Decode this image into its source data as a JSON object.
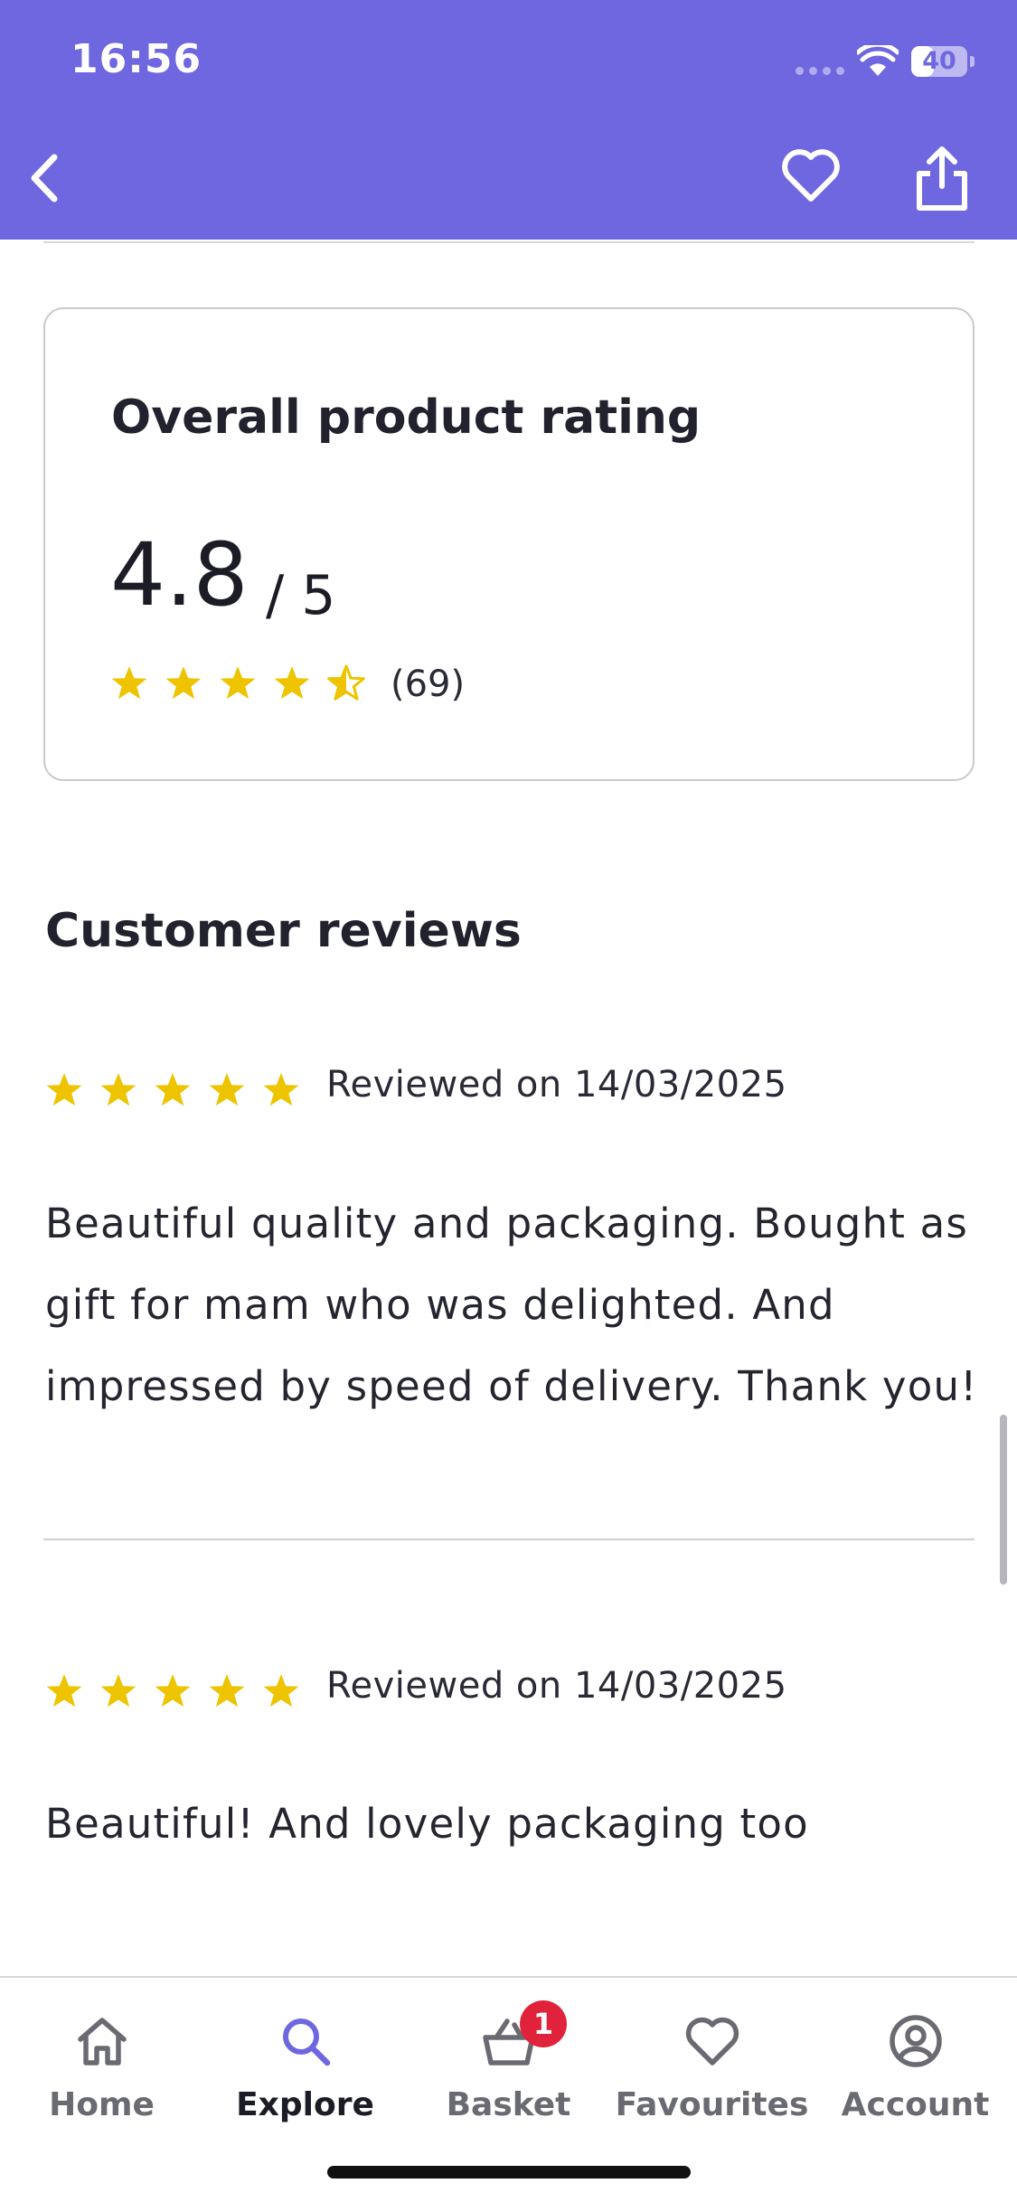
{
  "status_bar": {
    "time": "16:56",
    "battery": "40",
    "battery_level": 0.4
  },
  "header": {
    "back_icon": "chevron-left-icon",
    "favourite_icon": "heart-outline-icon",
    "share_icon": "share-icon"
  },
  "colors": {
    "header_bg": "#6f67df",
    "star": "#eec400",
    "badge": "#e0223b",
    "explore_active": "#6f67df"
  },
  "rating_card": {
    "title": "Overall product rating",
    "value": "4.8",
    "out_of": "/ 5",
    "stars": 4.5,
    "count": "(69)"
  },
  "reviews": {
    "title": "Customer reviews",
    "items": [
      {
        "stars": 5,
        "date": "Reviewed on 14/03/2025",
        "lines": [
          "Beautiful quality and packaging. Bought as",
          "gift for mam who was delighted. And",
          "impressed by speed of delivery.  Thank you!"
        ]
      },
      {
        "stars": 5,
        "date": "Reviewed on 14/03/2025",
        "lines": [
          "Beautiful! And lovely packaging too"
        ]
      }
    ]
  },
  "tabbar": {
    "active": "Explore",
    "items": [
      {
        "label": "Home",
        "icon": "home-icon"
      },
      {
        "label": "Explore",
        "icon": "search-icon"
      },
      {
        "label": "Basket",
        "icon": "basket-icon",
        "badge": "1"
      },
      {
        "label": "Favourites",
        "icon": "heart-icon"
      },
      {
        "label": "Account",
        "icon": "account-icon"
      }
    ]
  }
}
